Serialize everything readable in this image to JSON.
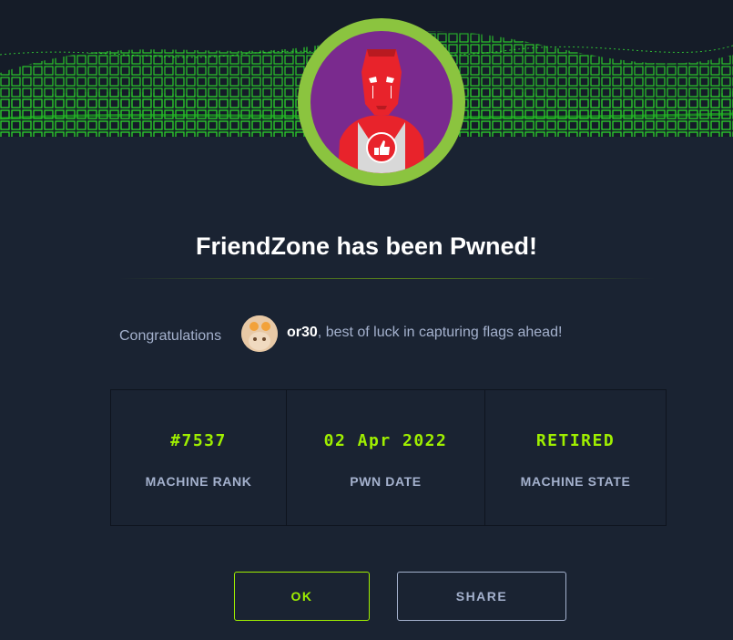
{
  "dialog": {
    "title": "FriendZone has been Pwned!",
    "congrats": {
      "lead": "Congratulations",
      "username": "or30",
      "message": ", best of luck in capturing flags ahead!"
    },
    "stats": [
      {
        "value": "#7537",
        "label": "MACHINE RANK"
      },
      {
        "value": "02 Apr 2022",
        "label": "PWN DATE"
      },
      {
        "value": "RETIRED",
        "label": "MACHINE STATE"
      }
    ],
    "buttons": {
      "ok": "OK",
      "share": "SHARE"
    }
  },
  "colors": {
    "background": "#1a2332",
    "accent_green": "#9fef00",
    "muted_text": "#a4b1cd",
    "avatar_ring": "#8bc43f",
    "avatar_bg": "#7a2a8e",
    "mascot_red": "#e8232b"
  },
  "icons": {
    "banner": "green-cube-wave-banner",
    "machine_avatar": "red-superhero-thumbs-up-avatar",
    "user_avatar": "user-avatar-photo"
  }
}
